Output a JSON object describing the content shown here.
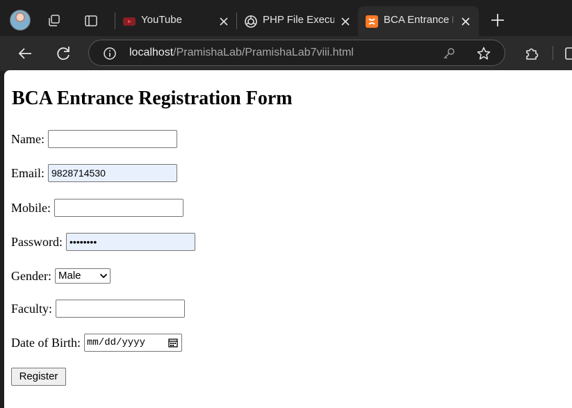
{
  "browser": {
    "tabs": [
      {
        "label": "YouTube",
        "favicon": "youtube-icon",
        "active": false
      },
      {
        "label": "PHP File Executi",
        "favicon": "chatgpt-icon",
        "active": false
      },
      {
        "label": "BCA Entrance R",
        "favicon": "xampp-icon",
        "active": true
      }
    ],
    "address": {
      "host": "localhost",
      "path": "/PramishaLab/PramishaLab7viii.html"
    },
    "colors": {
      "chrome_bg": "#1f1f1f",
      "toolbar_bg": "#2b2b2b",
      "youtube_red": "#c4302b",
      "xampp_orange": "#fb7a24"
    }
  },
  "page": {
    "title": "BCA Entrance Registration Form",
    "form": {
      "name_label": "Name:",
      "name_value": "",
      "email_label": "Email:",
      "email_value": "9828714530",
      "mobile_label": "Mobile:",
      "mobile_value": "",
      "password_label": "Password:",
      "password_value": "••••••••",
      "gender_label": "Gender:",
      "gender_selected": "Male",
      "faculty_label": "Faculty:",
      "faculty_value": "",
      "dob_label": "Date of Birth:",
      "dob_placeholder": "mm/dd/yyyy",
      "register_label": "Register"
    },
    "colors": {
      "autofill_bg": "#e8f0fe"
    }
  }
}
